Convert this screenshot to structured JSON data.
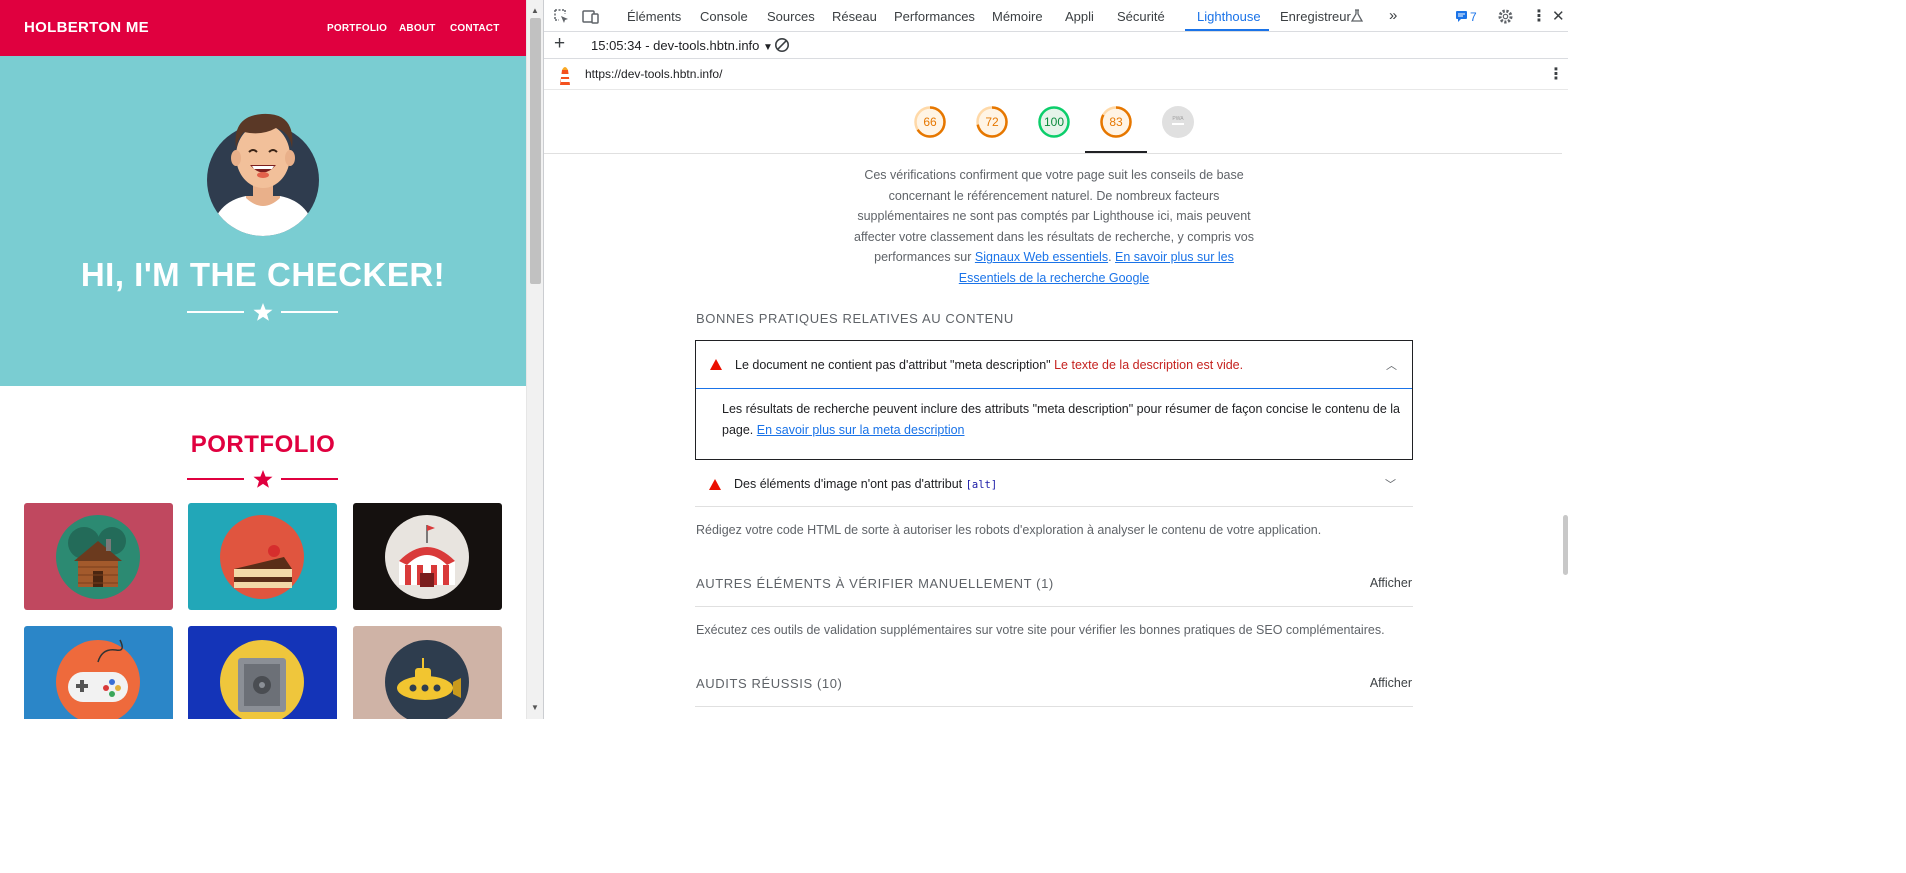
{
  "site": {
    "brand": "HOLBERTON ME",
    "nav": [
      "PORTFOLIO",
      "ABOUT",
      "CONTACT"
    ],
    "hero_title": "HI, I'M THE CHECKER!",
    "portfolio_title": "PORTFOLIO",
    "colors": {
      "primary": "#e0003f",
      "hero_bg": "#7acdd2"
    },
    "tiles": [
      {
        "icon": "cabin-icon",
        "bg": "#c0485f"
      },
      {
        "icon": "cake-icon",
        "bg": "#22a7b8"
      },
      {
        "icon": "circus-tent-icon",
        "bg": "#15110f"
      },
      {
        "icon": "game-controller-icon",
        "bg": "#2b86c8"
      },
      {
        "icon": "safe-icon",
        "bg": "#1434b8"
      },
      {
        "icon": "submarine-icon",
        "bg": "#cfb3a6"
      }
    ]
  },
  "devtools": {
    "tabs": [
      "Éléments",
      "Console",
      "Sources",
      "Réseau",
      "Performances",
      "Mémoire",
      "Appli",
      "Sécurité",
      "Lighthouse",
      "Enregistreur"
    ],
    "active_tab": "Lighthouse",
    "issues_count": "7",
    "report_time": "15:05:34 - dev-tools.hbtn.info",
    "report_url": "https://dev-tools.hbtn.info/",
    "scores": [
      {
        "value": "66",
        "color": "#e67700"
      },
      {
        "value": "72",
        "color": "#e67700"
      },
      {
        "value": "100",
        "color": "#0c8a3d"
      },
      {
        "value": "83",
        "color": "#e67700"
      },
      {
        "value": "PWA",
        "color": "#9e9e9e"
      }
    ],
    "seo_description": {
      "text": "Ces vérifications confirment que votre page suit les conseils de base concernant le référencement naturel. De nombreux facteurs supplémentaires ne sont pas comptés par Lighthouse ici, mais peuvent affecter votre classement dans les résultats de recherche, y compris vos performances sur ",
      "link1": "Signaux Web essentiels",
      "sep": ". ",
      "link2": "En savoir plus sur les Essentiels de la recherche Google"
    },
    "content_group_title": "BONNES PRATIQUES RELATIVES AU CONTENU",
    "audit_meta": {
      "title": "Le document ne contient pas d'attribut \"meta description\"",
      "display_value": "Le texte de la description est vide.",
      "description": "Les résultats de recherche peuvent inclure des attributs \"meta description\" pour résumer de façon concise le contenu de la page. ",
      "learn_more": "En savoir plus sur la meta description"
    },
    "audit_alt": {
      "title": "Des éléments d'image n'ont pas d'attribut ",
      "code": "[alt]"
    },
    "crawl_description": "Rédigez votre code HTML de sorte à autoriser les robots d'exploration à analyser le contenu de votre application.",
    "manual_title": "AUTRES ÉLÉMENTS À VÉRIFIER MANUELLEMENT (1)",
    "manual_show": "Afficher",
    "manual_description": "Exécutez ces outils de validation supplémentaires sur votre site pour vérifier les bonnes pratiques de SEO complémentaires.",
    "passed_title": "AUDITS RÉUSSIS (10)",
    "passed_show": "Afficher"
  }
}
